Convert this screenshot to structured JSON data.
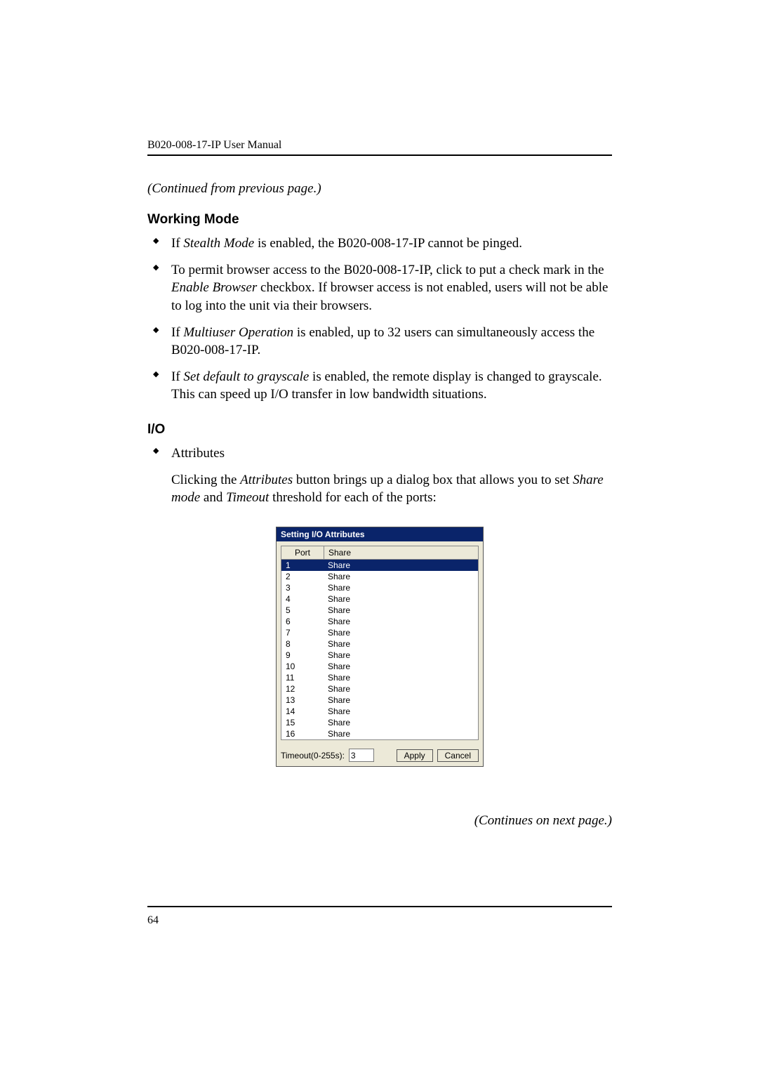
{
  "header": {
    "manual_title": "B020-008-17-IP User Manual"
  },
  "continued_note": "(Continued from previous page.)",
  "working_mode": {
    "heading": "Working Mode",
    "b1_pre": "If ",
    "b1_em": "Stealth Mode",
    "b1_post": " is enabled, the B020-008-17-IP cannot be pinged.",
    "b2_pre": "To permit browser access to the B020-008-17-IP, click to put a check mark in the ",
    "b2_em": "Enable Browser",
    "b2_post": " checkbox. If browser access is not enabled, users will not be able to log into the unit via their browsers.",
    "b3_pre": "If ",
    "b3_em": "Multiuser Operation",
    "b3_post": " is enabled, up to 32 users can simultaneously access the B020-008-17-IP.",
    "b4_pre": "If ",
    "b4_em": "Set default to grayscale",
    "b4_post": " is enabled, the remote display is changed to grayscale. This can speed up I/O transfer in low bandwidth situations."
  },
  "io": {
    "heading": "I/O",
    "b1": "Attributes",
    "desc_pre": "Clicking the ",
    "desc_em1": "Attributes",
    "desc_mid1": " button brings up a dialog box that allows you to set ",
    "desc_em2": "Share mode",
    "desc_mid2": " and ",
    "desc_em3": "Timeout",
    "desc_post": " threshold for each of the ports:"
  },
  "dialog": {
    "title": "Setting I/O Attributes",
    "col_port": "Port",
    "col_share": "Share",
    "rows": [
      {
        "port": "1",
        "share": "Share",
        "selected": true
      },
      {
        "port": "2",
        "share": "Share",
        "selected": false
      },
      {
        "port": "3",
        "share": "Share",
        "selected": false
      },
      {
        "port": "4",
        "share": "Share",
        "selected": false
      },
      {
        "port": "5",
        "share": "Share",
        "selected": false
      },
      {
        "port": "6",
        "share": "Share",
        "selected": false
      },
      {
        "port": "7",
        "share": "Share",
        "selected": false
      },
      {
        "port": "8",
        "share": "Share",
        "selected": false
      },
      {
        "port": "9",
        "share": "Share",
        "selected": false
      },
      {
        "port": "10",
        "share": "Share",
        "selected": false
      },
      {
        "port": "11",
        "share": "Share",
        "selected": false
      },
      {
        "port": "12",
        "share": "Share",
        "selected": false
      },
      {
        "port": "13",
        "share": "Share",
        "selected": false
      },
      {
        "port": "14",
        "share": "Share",
        "selected": false
      },
      {
        "port": "15",
        "share": "Share",
        "selected": false
      },
      {
        "port": "16",
        "share": "Share",
        "selected": false
      }
    ],
    "timeout_label": "Timeout(0-255s):",
    "timeout_value": "3",
    "apply": "Apply",
    "cancel": "Cancel"
  },
  "continues_note": "(Continues on next page.)",
  "page_number": "64"
}
